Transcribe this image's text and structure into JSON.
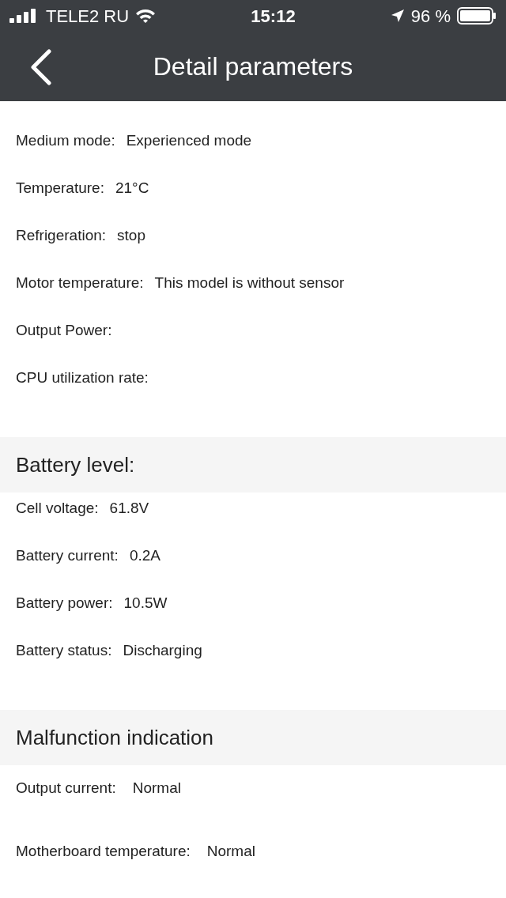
{
  "status_bar": {
    "carrier": "TELE2 RU",
    "time": "15:12",
    "battery_text": "96 %"
  },
  "nav": {
    "title": "Detail parameters"
  },
  "sections": [
    {
      "kind": "info",
      "rows": [
        {
          "label": "Medium mode:",
          "value": "Experienced mode"
        },
        {
          "label": "Temperature:",
          "value": "21°C"
        },
        {
          "label": "Refrigeration:",
          "value": "stop"
        },
        {
          "label": "Motor temperature:",
          "value": "This model is without sensor"
        },
        {
          "label": "Output Power:"
        },
        {
          "label": "CPU utilization rate:"
        }
      ]
    },
    {
      "kind": "info",
      "title": "Battery level:",
      "rows": [
        {
          "label": "Cell voltage:",
          "value": "61.8V"
        },
        {
          "label": "Battery current:",
          "value": "0.2A"
        },
        {
          "label": "Battery power:",
          "value": "10.5W"
        },
        {
          "label": "Battery status:",
          "value": "Discharging"
        }
      ]
    },
    {
      "kind": "fault",
      "title": "Malfunction indication",
      "rows": [
        {
          "label": "Output current:",
          "value": "Normal"
        },
        {
          "label": "Motherboard temperature:",
          "value": "Normal"
        }
      ]
    }
  ]
}
